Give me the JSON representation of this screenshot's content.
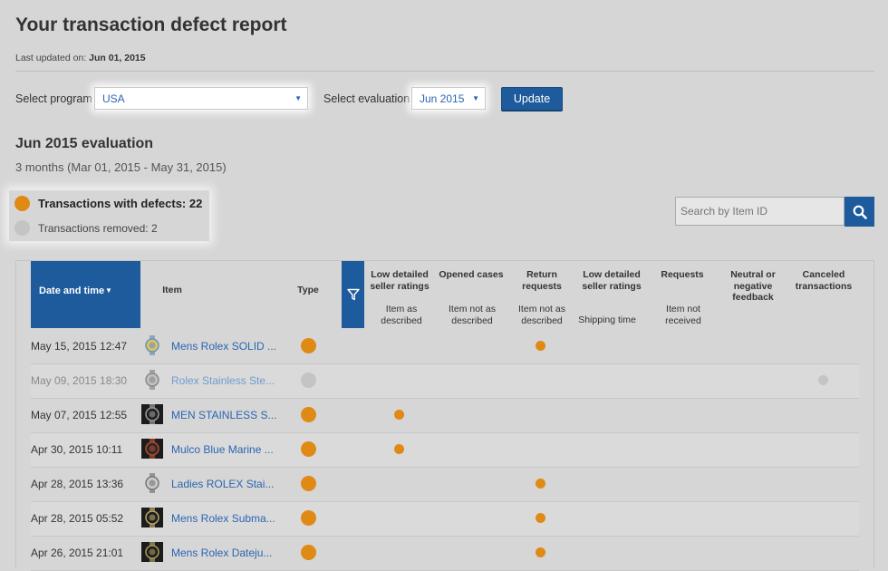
{
  "header": {
    "title": "Your transaction defect report",
    "last_updated_label": "Last updated on:",
    "last_updated_value": "Jun 01, 2015"
  },
  "filters": {
    "program_label": "Select program",
    "program_value": "USA",
    "evaluation_label": "Select evaluation",
    "evaluation_value": "Jun 2015",
    "update_label": "Update"
  },
  "evaluation": {
    "title": "Jun 2015 evaluation",
    "range": "3 months (Mar 01, 2015 - May 31, 2015)"
  },
  "legend": {
    "defects_label": "Transactions with defects: 22",
    "removed_label": "Transactions removed: 2"
  },
  "search": {
    "placeholder": "Search by Item ID"
  },
  "colors": {
    "accent": "#1d5b9c",
    "defect": "#e08a16",
    "removed": "#c4c4c4",
    "link": "#2a65b2"
  },
  "table": {
    "headers": {
      "date": "Date and time",
      "item": "Item",
      "type": "Type",
      "low_ratings_1": "Low detailed seller ratings",
      "low_ratings_1_sub": "Item as described",
      "opened_cases": "Opened cases",
      "opened_cases_sub": "Item not as described",
      "return_requests": "Return requests",
      "return_requests_sub": "Item not as described",
      "low_ratings_2": "Low detailed seller ratings",
      "low_ratings_2_sub": "Shipping time",
      "requests": "Requests",
      "requests_sub": "Item not received",
      "neutral": "Neutral or negative feedback",
      "canceled": "Canceled transactions"
    },
    "rows": [
      {
        "date": "May 15, 2015 12:47",
        "item": "Mens Rolex SOLID ...",
        "status": "defect",
        "column": "return_requests"
      },
      {
        "date": "May 09, 2015 18:30",
        "item": "Rolex Stainless Ste...",
        "status": "removed",
        "column": "canceled"
      },
      {
        "date": "May 07, 2015 12:55",
        "item": "MEN STAINLESS S...",
        "status": "defect",
        "column": "low_ratings_1"
      },
      {
        "date": "Apr 30, 2015 10:11",
        "item": "Mulco Blue Marine ...",
        "status": "defect",
        "column": "low_ratings_1"
      },
      {
        "date": "Apr 28, 2015 13:36",
        "item": "Ladies ROLEX Stai...",
        "status": "defect",
        "column": "return_requests"
      },
      {
        "date": "Apr 28, 2015 05:52",
        "item": "Mens Rolex Subma...",
        "status": "defect",
        "column": "return_requests"
      },
      {
        "date": "Apr 26, 2015 21:01",
        "item": "Mens Rolex Dateju...",
        "status": "defect",
        "column": "return_requests"
      }
    ]
  }
}
